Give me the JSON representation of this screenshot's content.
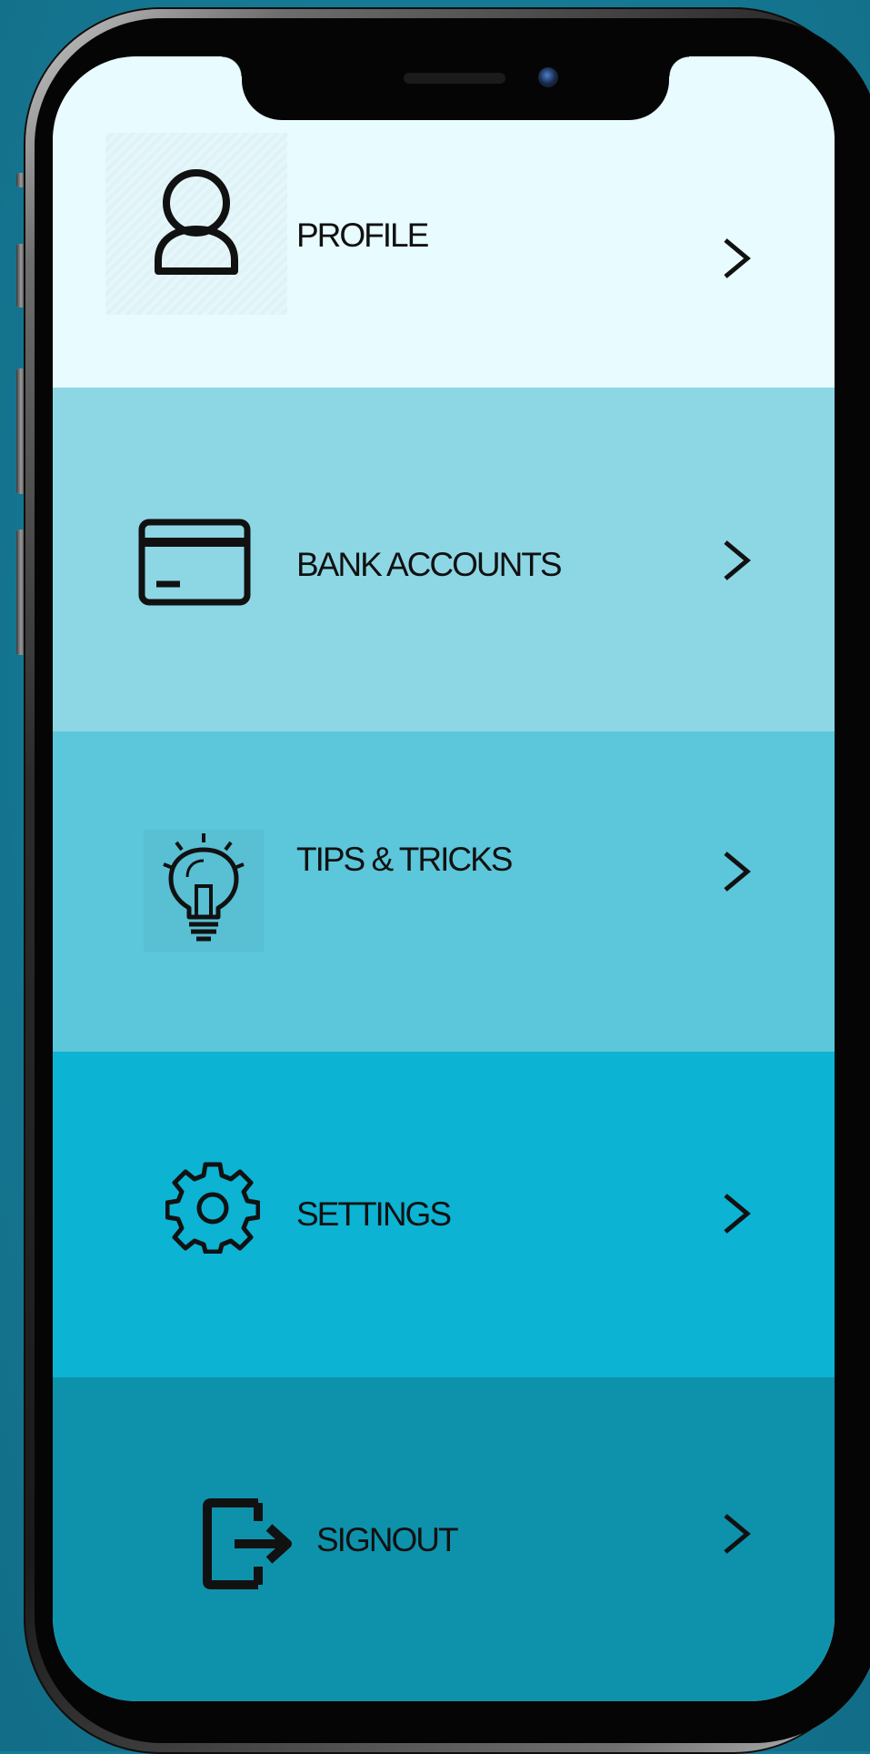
{
  "menu": {
    "items": [
      {
        "label": "PROFILE",
        "icon": "user-icon",
        "bg": "#e8fbff"
      },
      {
        "label": "BANK ACCOUNTS",
        "icon": "credit-card-icon",
        "bg": "#8dd7e5"
      },
      {
        "label": "TIPS & TRICKS",
        "icon": "lightbulb-icon",
        "bg": "#5cc6da"
      },
      {
        "label": "SETTINGS",
        "icon": "gear-icon",
        "bg": "#0cb3d3"
      },
      {
        "label": "SIGNOUT",
        "icon": "signout-icon",
        "bg": "#0e92ac"
      }
    ],
    "chevron_icon": "chevron-right-icon"
  },
  "colors": {
    "background": "#167b98",
    "text": "#111111"
  }
}
